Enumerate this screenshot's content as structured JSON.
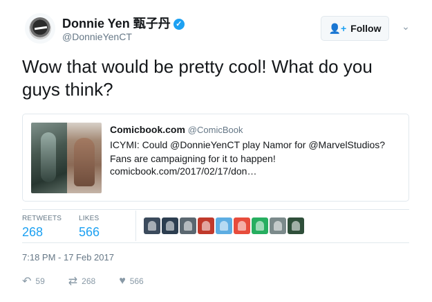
{
  "author": {
    "name": "Donnie Yen 甄子丹",
    "handle": "@DonnieYenCT",
    "verified_icon": "verified-badge-icon",
    "avatar_icon": "profile-avatar"
  },
  "follow_button": {
    "label": "Follow",
    "icon": "add-user-icon"
  },
  "menu_caret_icon": "chevron-down-icon",
  "tweet": {
    "text": "Wow that would be pretty cool! What do you guys think?"
  },
  "card": {
    "site_name": "Comicbook.com",
    "site_handle": "@ComicBook",
    "description": "ICYMI: Could @DonnieYenCT play Namor for @MarvelStudios? Fans are campaigning for it to happen!",
    "link": "comicbook.com/2017/02/17/don…"
  },
  "stats": {
    "retweets_label": "RETWEETS",
    "retweets": "268",
    "likes_label": "LIKES",
    "likes": "566"
  },
  "likers": [
    {
      "color": "#3b4a5c"
    },
    {
      "color": "#2c3e50"
    },
    {
      "color": "#5a6770"
    },
    {
      "color": "#c0392b"
    },
    {
      "color": "#5dade2"
    },
    {
      "color": "#e74c3c"
    },
    {
      "color": "#27ae60"
    },
    {
      "color": "#7b8a8b"
    },
    {
      "color": "#2f4f3a"
    }
  ],
  "timestamp": "7:18 PM - 17 Feb 2017",
  "actions": {
    "reply_icon": "reply-icon",
    "reply_count": "59",
    "retweet_icon": "retweet-icon",
    "retweet_count": "268",
    "like_icon": "heart-icon",
    "like_count": "566"
  },
  "colors": {
    "accent": "#1da1f2",
    "muted": "#657786",
    "border": "#e1e8ed"
  }
}
